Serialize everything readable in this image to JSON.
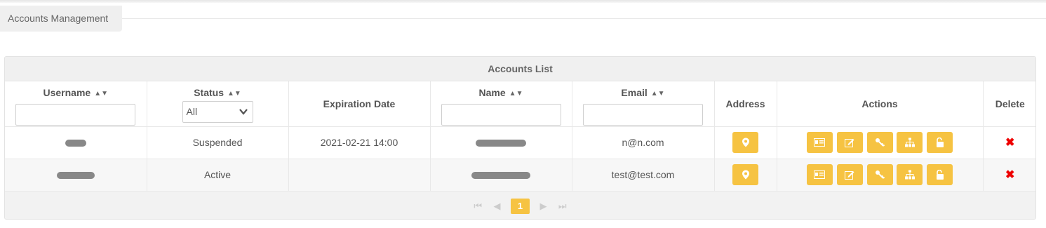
{
  "tab": {
    "label": "Accounts Management"
  },
  "panel": {
    "title": "Accounts List"
  },
  "columns": {
    "username": "Username",
    "status": "Status",
    "expiration": "Expiration Date",
    "name": "Name",
    "email": "Email",
    "address": "Address",
    "actions": "Actions",
    "delete": "Delete"
  },
  "filters": {
    "status_selected": "All"
  },
  "rows": [
    {
      "status": "Suspended",
      "expiration": "2021-02-21 14:00",
      "email": "n@n.com"
    },
    {
      "status": "Active",
      "expiration": "",
      "email": "test@test.com"
    }
  ],
  "pagination": {
    "current_page": "1"
  },
  "icons": {
    "sort": "sort-icon",
    "address": "map-marker-icon",
    "actions": [
      "id-card-icon",
      "edit-icon",
      "key-icon",
      "sitemap-icon",
      "unlock-icon"
    ],
    "delete": "close-icon",
    "pager": [
      "first-page-icon",
      "prev-page-icon",
      "next-page-icon",
      "last-page-icon"
    ]
  },
  "colors": {
    "accent": "#f6c342",
    "delete": "#e00000"
  }
}
